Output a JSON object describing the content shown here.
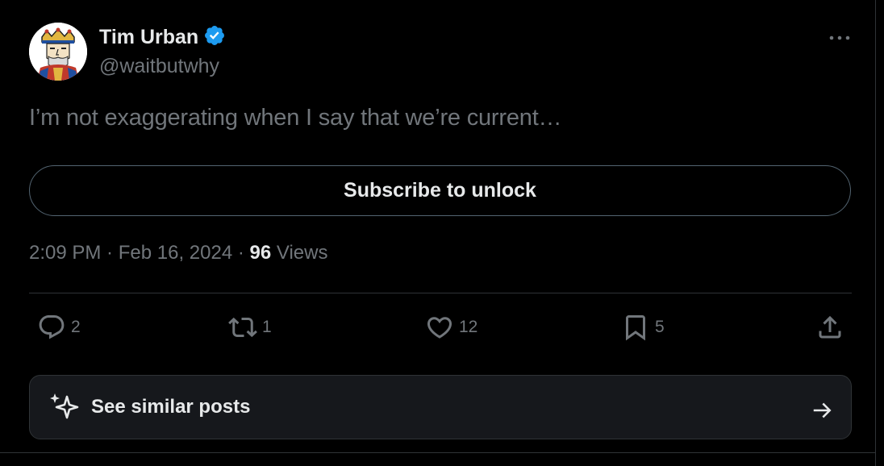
{
  "author": {
    "name": "Tim Urban",
    "handle": "@waitbutwhy",
    "verified": true,
    "verified_color": "#1d9bf0"
  },
  "tweet": {
    "text": "I’m not exaggerating when I say that we’re current…",
    "subscribe_label": "Subscribe to unlock"
  },
  "meta": {
    "time": "2:09 PM",
    "sep1": " · ",
    "date": "Feb 16, 2024",
    "sep2": " · ",
    "views_count": "96",
    "views_label": " Views"
  },
  "actions": {
    "replies": "2",
    "reposts": "1",
    "likes": "12",
    "bookmarks": "5"
  },
  "similar": {
    "label": "See similar posts"
  },
  "icons": {
    "more": "more-icon",
    "reply": "reply-icon",
    "repost": "repost-icon",
    "like": "heart-icon",
    "bookmark": "bookmark-icon",
    "share": "share-icon",
    "sparkle": "sparkle-icon",
    "arrow": "arrow-right-icon"
  },
  "colors": {
    "background": "#000000",
    "text_primary": "#e7e9ea",
    "text_secondary": "#71767b",
    "border": "#2f3336",
    "card_bg": "#16181c"
  }
}
